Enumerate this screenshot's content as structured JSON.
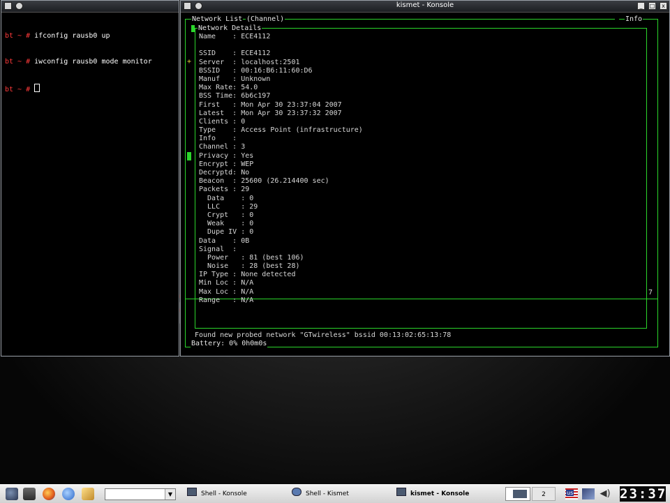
{
  "shell_window": {
    "lines": [
      {
        "prompt": "bt ~ #",
        "command": " ifconfig rausb0 up"
      },
      {
        "prompt": "bt ~ #",
        "command": " iwconfig rausb0 mode monitor"
      },
      {
        "prompt": "bt ~ #",
        "command": " "
      }
    ]
  },
  "kismet_window": {
    "title": "kismet - Konsole",
    "header": {
      "network_list": "Network List",
      "channel": "(Channel)",
      "info": "Info"
    },
    "panel_title": "Network Details",
    "details": [
      "Name    : ECE4112",
      "",
      "SSID    : ECE4112",
      "Server  : localhost:2501",
      "BSSID   : 00:16:B6:11:60:D6",
      "Manuf   : Unknown",
      "Max Rate: 54.0",
      "BSS Time: 6b6c197",
      "First   : Mon Apr 30 23:37:04 2007",
      "Latest  : Mon Apr 30 23:37:32 2007",
      "Clients : 0",
      "Type    : Access Point (infrastructure)",
      "Info    :",
      "Channel : 3",
      "Privacy : Yes",
      "Encrypt : WEP",
      "Decryptd: No",
      "Beacon  : 25600 (26.214400 sec)",
      "Packets : 29",
      "  Data    : 0",
      "  LLC     : 29",
      "  Crypt   : 0",
      "  Weak    : 0",
      "  Dupe IV : 0",
      "Data    : 0B",
      "Signal  :",
      "  Power   : 81 (best 106)",
      "  Noise   : 28 (best 28)",
      "IP Type : None detected",
      "Min Loc : N/A",
      "Max Loc : N/A",
      "Range   : N/A"
    ],
    "side_marker_yellow": "+",
    "side_marker_right": "7",
    "status_message": "Found new probed network \"GTwireless\" bssid 00:13:02:65:13:78",
    "battery": "Battery: 0% 0h0m0s"
  },
  "taskbar": {
    "tasks": [
      {
        "label": "Shell - Konsole"
      },
      {
        "label": "Shell - Kismet"
      },
      {
        "label": "kismet - Konsole"
      }
    ],
    "desktop_number": "2",
    "keyboard_layout": "us",
    "clock": "23:37"
  },
  "icons": {
    "launcher": [
      "kmenu-icon",
      "show-desktop-icon",
      "firefox-icon",
      "browser-icon",
      "edit-icon"
    ],
    "tray": [
      "flag-icon",
      "network-icon",
      "volume-icon"
    ]
  },
  "colors": {
    "prompt": "#ff3a3a",
    "kismet_border": "#2bd62b",
    "marker_yellow": "#e8d43a"
  }
}
